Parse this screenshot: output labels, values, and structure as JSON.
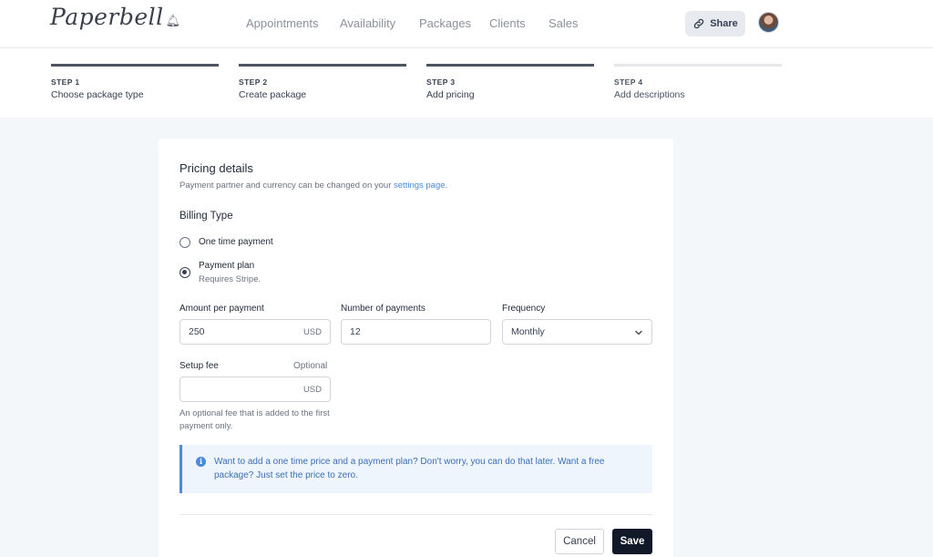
{
  "header": {
    "logo_text": "Paperbell",
    "nav": [
      "Appointments",
      "Availability",
      "Packages",
      "Clients",
      "Sales"
    ],
    "share_label": "Share"
  },
  "steps": [
    {
      "num": "STEP 1",
      "name": "Choose package type",
      "status": "complete"
    },
    {
      "num": "STEP 2",
      "name": "Create package",
      "status": "complete"
    },
    {
      "num": "STEP 3",
      "name": "Add pricing",
      "status": "current"
    },
    {
      "num": "STEP 4",
      "name": "Add descriptions",
      "status": "pending"
    }
  ],
  "pricing": {
    "title": "Pricing details",
    "subtitle_prefix": "Payment partner and currency can be changed on your ",
    "subtitle_link": "settings page",
    "subtitle_suffix": ".",
    "billing_type_label": "Billing Type",
    "options": [
      {
        "label": "One time payment",
        "selected": false
      },
      {
        "label": "Payment plan",
        "sub": "Requires Stripe.",
        "selected": true
      }
    ],
    "amount_label": "Amount per payment",
    "amount_value": "250",
    "amount_unit": "USD",
    "num_payments_label": "Number of payments",
    "num_payments_value": "12",
    "frequency_label": "Frequency",
    "frequency_value": "Monthly",
    "setup_fee_label": "Setup fee",
    "setup_fee_optional": "Optional",
    "setup_fee_value": "",
    "setup_fee_unit": "USD",
    "setup_fee_hint": "An optional fee that is added to the first payment only.",
    "info_text": "Want to add a one time price and a payment plan? Don't worry, you can do that later. Want a free package? Just set the price to zero.",
    "cancel_label": "Cancel",
    "save_label": "Save"
  },
  "colors": {
    "accent": "#4a89dc",
    "primary_button": "#111827",
    "background": "#f3f7fa"
  }
}
